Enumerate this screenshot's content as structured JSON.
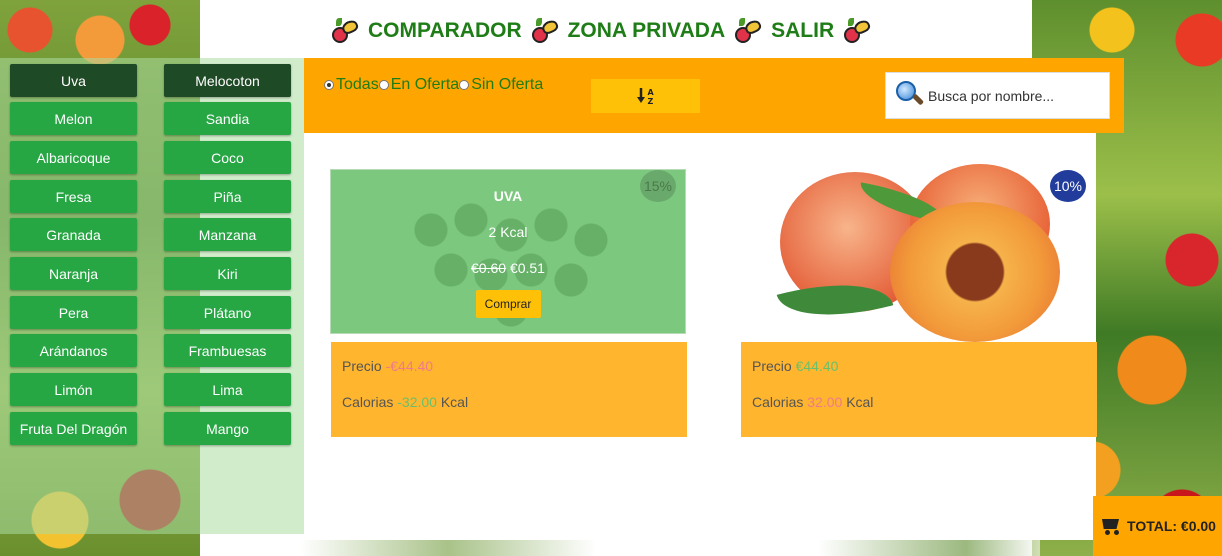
{
  "nav": {
    "comparador": "COMPARADOR",
    "zona_privada": "ZONA PRIVADA",
    "salir": "SALIR"
  },
  "fruits_left": [
    "Uva",
    "Melon",
    "Albaricoque",
    "Fresa",
    "Granada",
    "Naranja",
    "Pera",
    "Arándanos",
    "Limón",
    "Fruta Del Dragón"
  ],
  "fruits_right": [
    "Melocoton",
    "Sandia",
    "Coco",
    "Piña",
    "Manzana",
    "Kiri",
    "Plátano",
    "Frambuesas",
    "Lima",
    "Mango"
  ],
  "active_fruits": [
    "Uva",
    "Melocoton"
  ],
  "filters": {
    "options": [
      "Todas",
      "En Oferta",
      "Sin Oferta"
    ],
    "selected": "Todas"
  },
  "sort": {
    "icon": "sort-alpha-down-icon"
  },
  "search": {
    "placeholder": "Busca por nombre..."
  },
  "product_left": {
    "name": "UVA",
    "kcal": "2 Kcal",
    "old_price": "€0.60",
    "new_price": "€0.51",
    "buy_label": "Comprar",
    "discount": "15%"
  },
  "product_right": {
    "discount": "10%"
  },
  "compare_left": {
    "price_label": "Precio",
    "price_value": "-€44.40",
    "cal_label": "Calorias",
    "cal_value": "-32.00",
    "cal_unit": "Kcal"
  },
  "compare_right": {
    "price_label": "Precio",
    "price_value": "€44.40",
    "cal_label": "Calorias",
    "cal_value": "32.00",
    "cal_unit": "Kcal"
  },
  "cart": {
    "label": "TOTAL: €0.00"
  },
  "colors": {
    "nav_green": "#1e7d16",
    "button_green": "#27a644",
    "button_active": "#1f4a26",
    "filter_orange": "#ffa500",
    "info_orange": "#ffb52e",
    "badge_blue": "#223c9c"
  }
}
